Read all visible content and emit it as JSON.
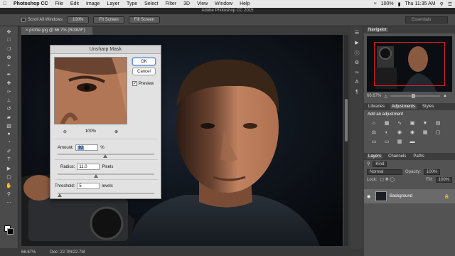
{
  "mac_menubar": {
    "app": "Photoshop CC",
    "menus": [
      "File",
      "Edit",
      "Image",
      "Layer",
      "Type",
      "Select",
      "Filter",
      "3D",
      "View",
      "Window",
      "Help"
    ],
    "battery": "100%",
    "clock": "Thu 11:35 AM"
  },
  "title_bar": {
    "title": "Adobe Photoshop CC 2015"
  },
  "options_bar": {
    "scroll_all_windows": "Scroll All Windows",
    "zoom_100": "100%",
    "fit_screen": "Fit Screen",
    "fill_screen": "Fill Screen",
    "workspace": "Essentials"
  },
  "document": {
    "tab_label": "profile.jpg @ 66.7% (RGB/8*)"
  },
  "status_bar": {
    "zoom": "66.67%",
    "doc_size": "Doc: 22.7M/22.7M"
  },
  "navigator": {
    "title": "Navigator",
    "zoom": "66.67%"
  },
  "adjustments": {
    "tabs": [
      "Libraries",
      "Adjustments",
      "Styles"
    ],
    "active_tab": "Adjustments",
    "heading": "Add an adjustment",
    "icons": [
      "brightness-icon",
      "levels-icon",
      "curves-icon",
      "exposure-icon",
      "vibrance-icon",
      "hue-saturation-icon",
      "color-balance-icon",
      "black-white-icon",
      "photo-filter-icon",
      "channel-mixer-icon",
      "color-lookup-icon",
      "invert-icon",
      "posterize-icon",
      "threshold-icon",
      "selective-color-icon",
      "gradient-map-icon"
    ]
  },
  "layers": {
    "tabs": [
      "Layers",
      "Channels",
      "Paths"
    ],
    "active_tab": "Layers",
    "kind_filter": "Kind",
    "blend_mode": "Normal",
    "opacity_label": "Opacity:",
    "opacity_value": "100%",
    "lock_label": "Lock:",
    "fill_label": "Fill:",
    "fill_value": "100%",
    "items": [
      {
        "name": "Background",
        "visible": true,
        "locked": true
      }
    ]
  },
  "dialog": {
    "title": "Unsharp Mask",
    "ok": "OK",
    "cancel": "Cancel",
    "preview_label": "Preview",
    "preview_checked": true,
    "preview_zoom": "100%",
    "amount_label": "Amount:",
    "amount_value": "92",
    "amount_unit": "%",
    "radius_label": "Radius:",
    "radius_value": "11.0",
    "radius_unit": "Pixels",
    "threshold_label": "Threshold:",
    "threshold_value": "5",
    "threshold_unit": "levels"
  }
}
